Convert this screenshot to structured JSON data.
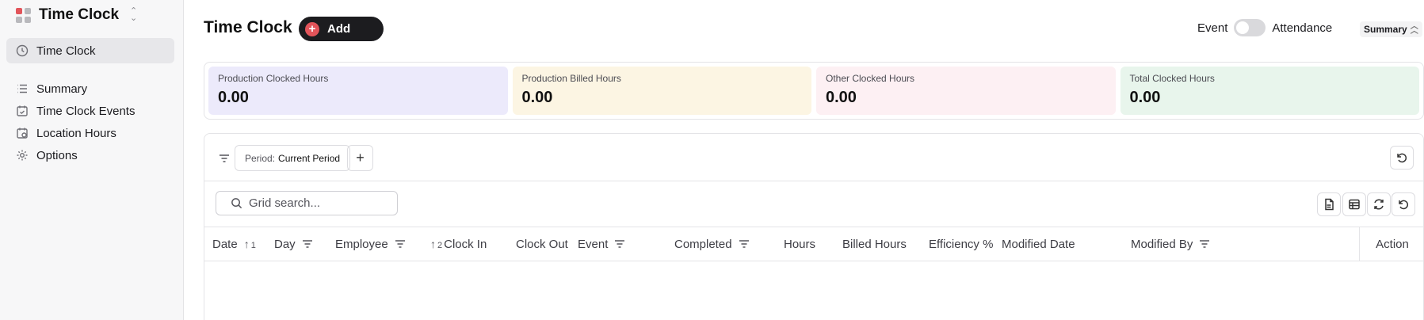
{
  "app": {
    "title": "Time Clock"
  },
  "sidebar": {
    "items": [
      {
        "label": "Time Clock",
        "icon": "clock-icon",
        "active": true
      },
      {
        "label": "Summary",
        "icon": "list-icon"
      },
      {
        "label": "Time Clock Events",
        "icon": "calendar-check-icon"
      },
      {
        "label": "Location Hours",
        "icon": "calendar-clock-icon"
      },
      {
        "label": "Options",
        "icon": "gear-icon"
      }
    ]
  },
  "header": {
    "title": "Time Clock",
    "add_label": "Add",
    "toggle_left": "Event",
    "toggle_right": "Attendance",
    "summary_label": "Summary"
  },
  "stats": [
    {
      "label": "Production Clocked Hours",
      "value": "0.00",
      "color": "#eceafb"
    },
    {
      "label": "Production Billed Hours",
      "value": "0.00",
      "color": "#fcf5e3"
    },
    {
      "label": "Other Clocked Hours",
      "value": "0.00",
      "color": "#fdf0f3"
    },
    {
      "label": "Total Clocked Hours",
      "value": "0.00",
      "color": "#e8f5ec"
    }
  ],
  "filters": {
    "period_key": "Period:",
    "period_value": "Current Period"
  },
  "search": {
    "placeholder": "Grid search..."
  },
  "columns": {
    "date": "Date",
    "date_sort": "1",
    "day": "Day",
    "employee": "Employee",
    "clock_in_sort": "2",
    "clock_in": "Clock In",
    "clock_out": "Clock Out",
    "event": "Event",
    "completed": "Completed",
    "hours": "Hours",
    "billed_hours": "Billed Hours",
    "efficiency": "Efficiency %",
    "modified_date": "Modified Date",
    "modified_by": "Modified By",
    "action": "Action"
  },
  "colors": {
    "accent": "#e2545a",
    "dark_button": "#1c1c1f"
  }
}
